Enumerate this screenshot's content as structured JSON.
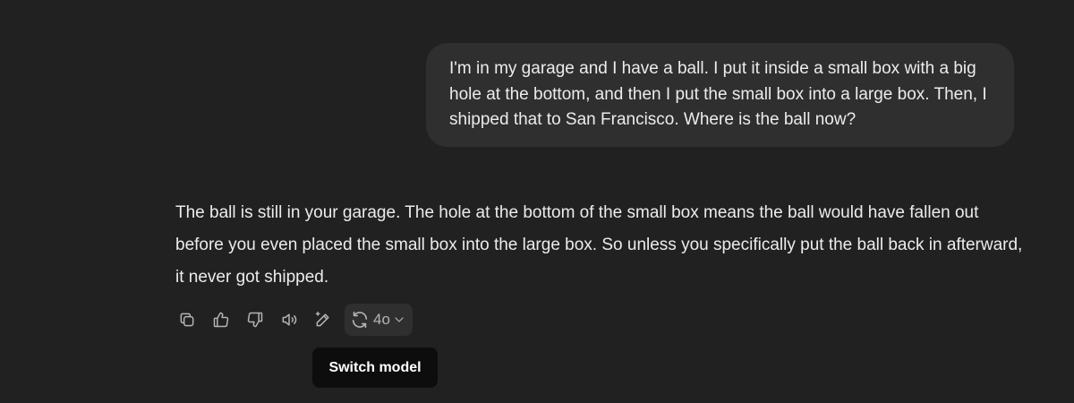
{
  "user_message": {
    "text": "I'm in my garage and I have a ball. I put it inside a small box with a big hole at the bottom, and then I put the small box into a large box. Then, I shipped that to San Francisco. Where is the ball now?"
  },
  "assistant_message": {
    "text": "The ball is still in your garage. The hole at the bottom of the small box means the ball would have fallen out before you even placed the small box into the large box. So unless you specifically put the ball back in afterward, it never got shipped."
  },
  "actions": {
    "icons": [
      "copy-icon",
      "thumbs-up-icon",
      "thumbs-down-icon",
      "read-aloud-icon",
      "edit-icon",
      "refresh-icon",
      "chevron-down-icon"
    ],
    "model_label": "4o"
  },
  "tooltip": {
    "text": "Switch model"
  },
  "colors": {
    "background": "#212121",
    "bubble": "#2f2f2f",
    "text": "#ececec",
    "icon": "#b4b4b4",
    "tooltip_bg": "#0d0d0d"
  }
}
